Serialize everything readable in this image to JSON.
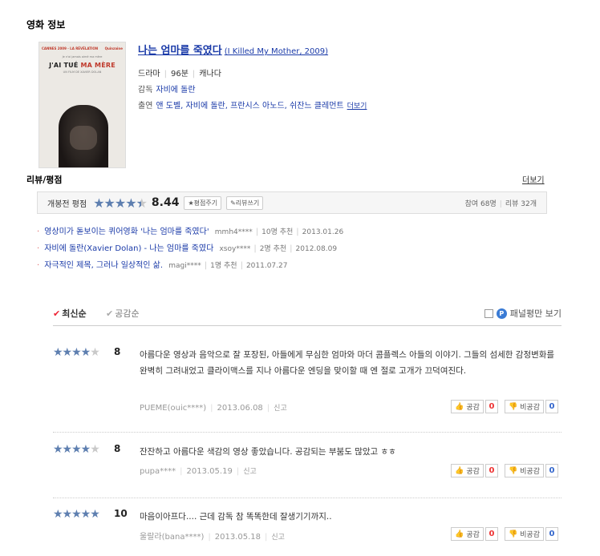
{
  "section_title": "영화 정보",
  "poster": {
    "festival": "CANNES 2009 · LA RÉVÉLATION",
    "brand": "Quinzaine",
    "tagline": "Je n'ai jamais aimé ma mère",
    "title_a": "J'AI TUÉ",
    "title_b": "MA MÈRE",
    "director": "UN FILM DE XAVIER DOLAN"
  },
  "movie": {
    "title": "나는 엄마를 죽였다",
    "original": "(I Killed My Mother, 2009)",
    "genre": "드라마",
    "runtime": "96분",
    "country": "캐나다",
    "director_label": "감독",
    "director": "자비에 돌란",
    "cast_label": "출연",
    "cast": "앤 도벨, 자비에 돌란, 프란시스 아노드, 쉬잔느 클레먼트",
    "more": "더보기"
  },
  "reviews_section": {
    "title": "리뷰/평점",
    "more": "더보기"
  },
  "rating_box": {
    "label": "개봉전 평점",
    "stars": 4.5,
    "score": "8.44",
    "btn_rate": "★평점주기",
    "btn_review": "✎리뷰쓰기",
    "participants": "참여 68명",
    "review_count": "리뷰 32개"
  },
  "mini_reviews": [
    {
      "title": "영상미가 돋보이는 퀴어영화 '나는 엄마를 죽였다'",
      "user": "mmh4****",
      "rec": "10명 추천",
      "date": "2013.01.26"
    },
    {
      "title": "자비에 돌란(Xavier Dolan) - 나는 엄마를 죽였다",
      "user": "xsoy****",
      "rec": "2명 추천",
      "date": "2012.08.09"
    },
    {
      "title": "자극적인 제목, 그러나 일상적인 삶.",
      "user": "magi****",
      "rec": "1명 추천",
      "date": "2011.07.27"
    }
  ],
  "sort": {
    "latest": "최신순",
    "empathy": "공감순",
    "panel_only": "패널평만 보기"
  },
  "reviews": [
    {
      "stars": 4,
      "score": "8",
      "text": "아름다운 영상과 음악으로 잘 포장된, 아들에게 무심한 엄마와 마더 콤플렉스 아들의 이야기. 그들의 섬세한 감정변화를 완벽히 그려내었고 클라이맥스를 지나 아름다운 엔딩을 맞이할 때 엔 절로 고개가 끄덕여진다.",
      "user": "PUEME(ouic****)",
      "date": "2013.06.08",
      "report": "신고",
      "agree": "공감",
      "agree_count": "0",
      "disagree": "비공감",
      "disagree_count": "0"
    },
    {
      "stars": 4,
      "score": "8",
      "text": "잔잔하고 아름다운 색감의 영상 좋았습니다. 공감되는 부붐도 많았고 ㅎㅎ",
      "user": "pupa****",
      "date": "2013.05.19",
      "report": "신고",
      "agree": "공감",
      "agree_count": "0",
      "disagree": "비공감",
      "disagree_count": "0"
    },
    {
      "stars": 5,
      "score": "10",
      "text": "마음이아프다.... 근데 감독 참 똑똑한데 잘생기기까지..",
      "user": "울랄라(bana****)",
      "date": "2013.05.18",
      "report": "신고",
      "agree": "공감",
      "agree_count": "0",
      "disagree": "비공감",
      "disagree_count": "0"
    }
  ]
}
